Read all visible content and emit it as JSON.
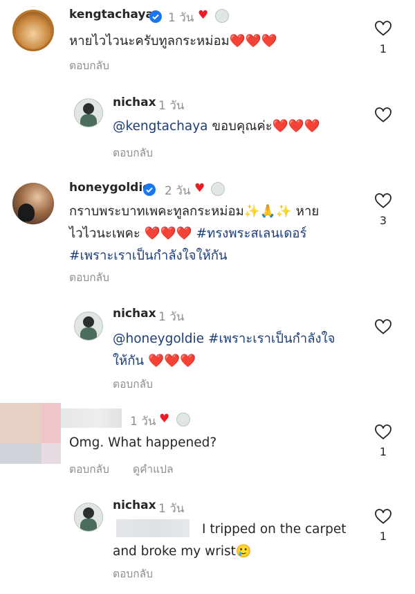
{
  "colors": {
    "hashtag": "#1b3e7a",
    "muted": "#8e8e8e",
    "heart": "#ed1c24",
    "verified": "#1877f2"
  },
  "comments": [
    {
      "username": "kengtachaya",
      "verified": true,
      "time": "1 วัน",
      "text": "หายไวไวนะครับทูลกระหม่อม❤️❤️❤️",
      "reply_label": "ตอบกลับ",
      "likes": "1"
    },
    {
      "username": "nichax",
      "time": "1 วัน",
      "mention": "@kengtachaya",
      "text": " ขอบคุณค่ะ❤️❤️❤️",
      "reply_label": "ตอบกลับ"
    },
    {
      "username": "honeygoldie",
      "verified": true,
      "time": "2 วัน",
      "text_line1": "กราบพระบาทเพคะทูลกระหม่อม✨🙏✨ หาย",
      "text_line2": "ไวไวนะเพคะ ❤️❤️❤️ ",
      "hashtag1": "#ทรงพระสเลนเดอร์",
      "hashtag2": "#เพราะเราเป็นกำลังใจให้กัน",
      "reply_label": "ตอบกลับ",
      "likes": "3"
    },
    {
      "username": "nichax",
      "time": "1 วัน",
      "mention": "@honeygoldie",
      "hashtag_line1": "#เพราะเราเป็นกำลังใจ",
      "hashtag_line2": "ให้กัน",
      "text": " ❤️❤️❤️",
      "reply_label": "ตอบกลับ"
    },
    {
      "time": "1 วัน",
      "text": "Omg. What happened?",
      "reply_label": "ตอบกลับ",
      "translate_label": "ดูคำแปล",
      "likes": "1"
    },
    {
      "username": "nichax",
      "time": "1 วัน",
      "text_line1": "I tripped on the carpet",
      "text_line2": "and broke my wrist🥲",
      "reply_label": "ตอบกลับ",
      "likes": "1"
    }
  ]
}
